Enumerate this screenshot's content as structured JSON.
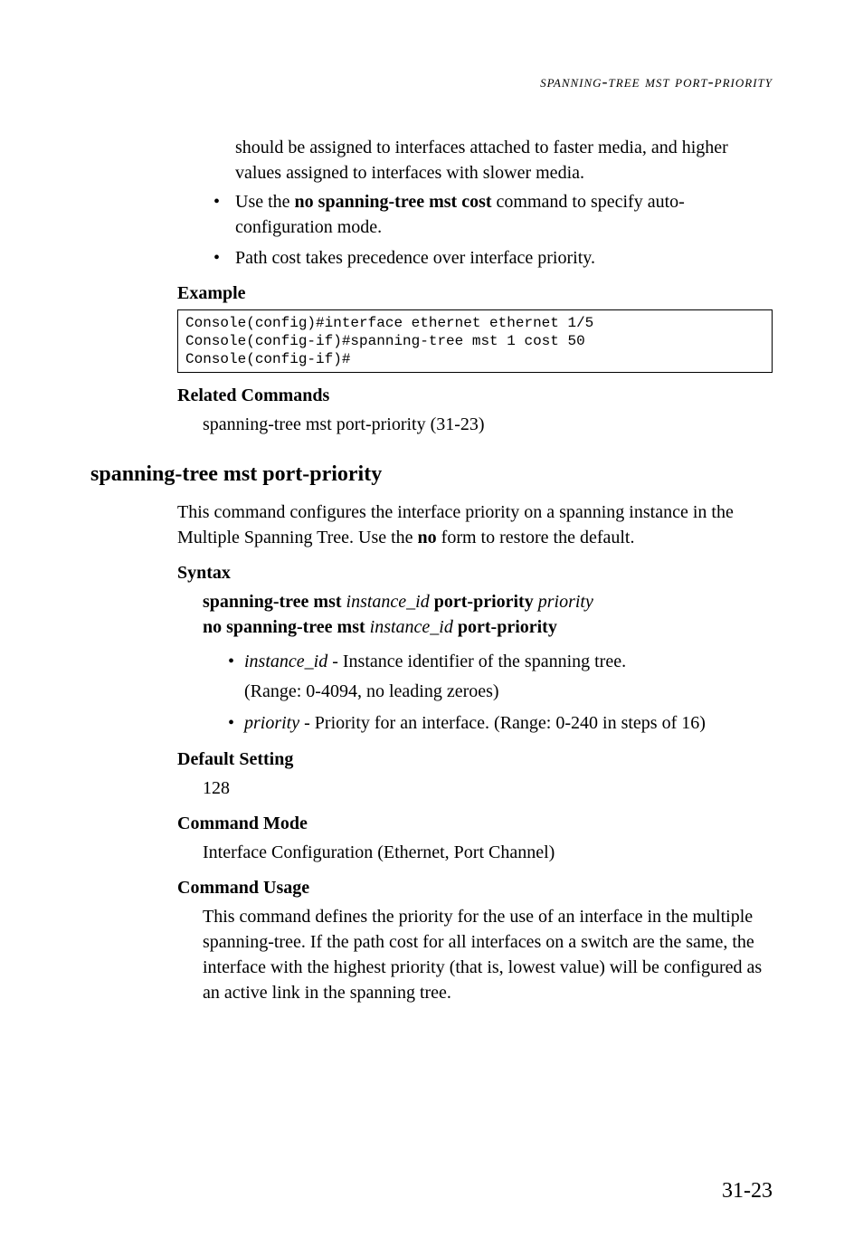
{
  "running_head": "spanning-tree mst port-priority",
  "intro_para": "should be assigned to interfaces attached to faster media, and higher values assigned to interfaces with slower media.",
  "top_bullets": {
    "b1_pre": "Use the ",
    "b1_bold": "no spanning-tree mst cost",
    "b1_post": " command to specify auto-configuration mode.",
    "b2": "Path cost takes precedence over interface priority."
  },
  "example_head": "Example",
  "code": "Console(config)#interface ethernet ethernet 1/5\nConsole(config-if)#spanning-tree mst 1 cost 50\nConsole(config-if)#",
  "related_head": "Related Commands",
  "related_line": "spanning-tree mst port-priority (31-23)",
  "section_head": "spanning-tree mst port-priority",
  "section_para_pre": "This command configures the interface priority on a spanning instance in the Multiple Spanning Tree. Use the ",
  "section_para_bold": "no",
  "section_para_post": " form to restore the default.",
  "syntax_head": "Syntax",
  "syntax_line1": {
    "a": "spanning-tree mst ",
    "b": "instance_id",
    "c": " port-priority ",
    "d": "priority"
  },
  "syntax_line2": {
    "a": "no spanning-tree mst ",
    "b": "instance_id",
    "c": " port-priority"
  },
  "syntax_bullets": {
    "i1_a": "instance_id",
    "i1_b": " - Instance identifier of the spanning tree.",
    "i1_sub": "(Range: 0-4094, no leading zeroes)",
    "i2_a": "priority",
    "i2_b": " - Priority for an interface. (Range: 0-240 in steps of 16)"
  },
  "default_head": "Default Setting",
  "default_val": "128",
  "mode_head": "Command Mode",
  "mode_val": "Interface Configuration (Ethernet, Port Channel)",
  "usage_head": "Command Usage",
  "usage_para": "This command defines the priority for the use of an interface in the multiple spanning-tree. If the path cost for all interfaces on a switch are the same, the interface with the highest priority (that is, lowest value) will be configured as an active link in the spanning tree.",
  "page_num": "31-23"
}
